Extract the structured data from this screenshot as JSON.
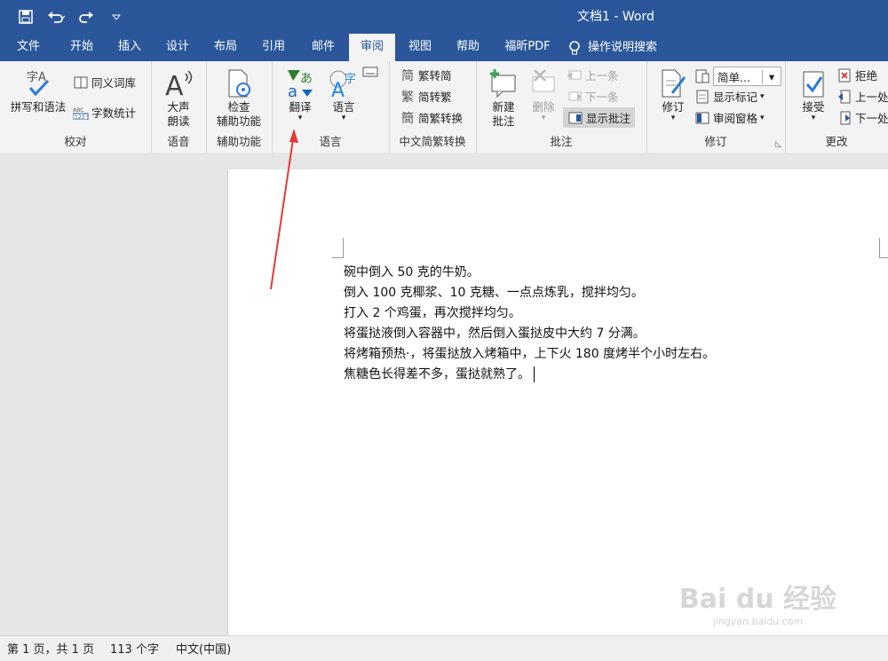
{
  "window": {
    "title": "文档1  -  Word"
  },
  "tabs": [
    "文件",
    "开始",
    "插入",
    "设计",
    "布局",
    "引用",
    "邮件",
    "审阅",
    "视图",
    "帮助",
    "福昕PDF"
  ],
  "search_label": "操作说明搜索",
  "groups": {
    "proofing": {
      "label": "校对",
      "spell": "拼写和语法",
      "thesaurus": "同义词库",
      "wordcount": "字数统计"
    },
    "speech": {
      "label": "语音",
      "read_aloud_1": "大声",
      "read_aloud_2": "朗读"
    },
    "accessibility": {
      "label": "辅助功能",
      "check_1": "检查",
      "check_2": "辅助功能"
    },
    "language": {
      "label": "语言",
      "translate": "翻译",
      "language": "语言"
    },
    "chinese": {
      "label": "中文简繁转换",
      "to_simplified": "繁转简",
      "to_traditional": "简转繁",
      "convert": "简繁转换"
    },
    "comments": {
      "label": "批注",
      "new_1": "新建",
      "new_2": "批注",
      "delete": "删除",
      "prev": "上一条",
      "next": "下一条",
      "show": "显示批注"
    },
    "tracking": {
      "label": "修订",
      "track": "修订",
      "markup_value": "简单...",
      "show_markup": "显示标记",
      "reviewing_pane": "审阅窗格"
    },
    "changes": {
      "label": "更改",
      "accept": "接受",
      "reject": "拒绝",
      "prev": "上一处",
      "next": "下一处"
    }
  },
  "document": {
    "lines": [
      "碗中倒入 50 克的牛奶。",
      "倒入 100 克椰浆、10 克糖、一点点炼乳，搅拌均匀。",
      "打入 2 个鸡蛋，再次搅拌均匀。",
      "将蛋挞液倒入容器中，然后倒入蛋挞皮中大约 7 分满。",
      "将烤箱预热·，将蛋挞放入烤箱中，上下火 180 度烤半个小时左右。",
      "焦糖色长得差不多，蛋挞就熟了。"
    ]
  },
  "status": {
    "page": "第 1 页，共 1 页",
    "words": "113 个字",
    "language": "中文(中国)"
  },
  "watermark": {
    "brand": "Bai du 经验",
    "url": "jingyan.baidu.com"
  },
  "colors": {
    "accent": "#2b579a",
    "annotation_arrow": "#e53935"
  }
}
